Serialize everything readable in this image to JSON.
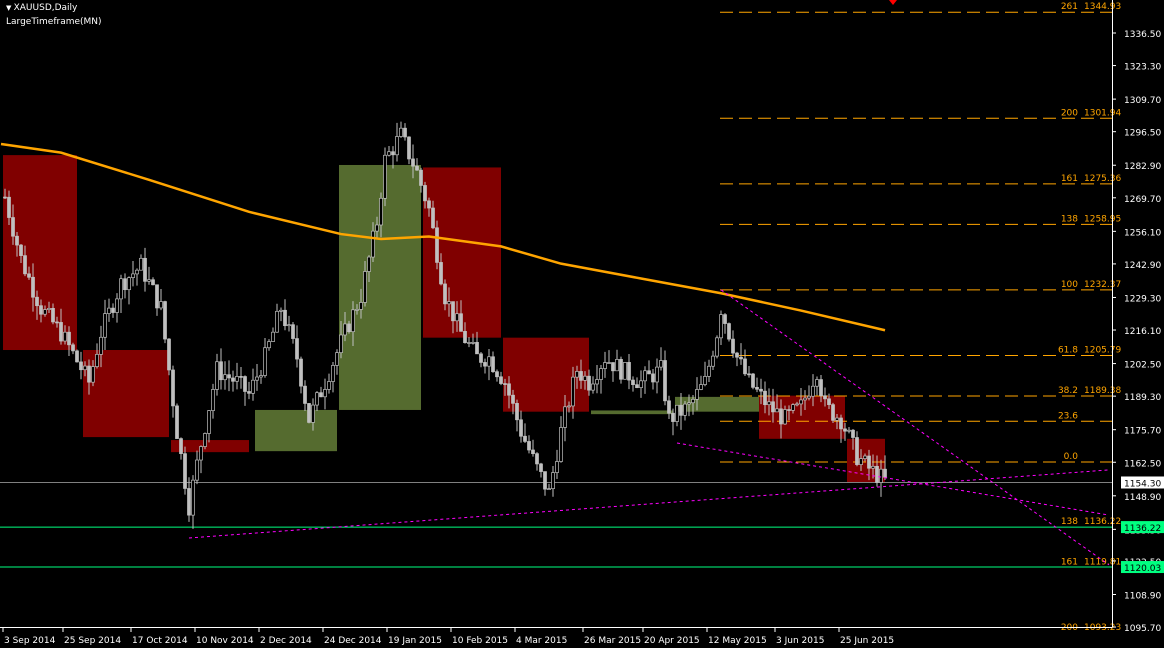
{
  "header": {
    "symbol_label": "XAUUSD,Daily",
    "indicator_label": "LargeTimeframe(MN)"
  },
  "colors": {
    "background": "#000000",
    "axis": "#ffffff",
    "candle": "#c0c0c0",
    "bear_box": "#800000",
    "bull_box": "#556b2f",
    "ma": "#ffa500",
    "fib": "#ffa500",
    "support": "#00ff80",
    "trend": "#ff00ff",
    "price_line": "#808080"
  },
  "chart_data": {
    "type": "candlestick",
    "title": "XAUUSD,Daily",
    "ylim": [
      1090,
      1350
    ],
    "y_ticks": [
      "1336.50",
      "1323.30",
      "1309.70",
      "1296.50",
      "1282.90",
      "1269.70",
      "1256.10",
      "1242.90",
      "1229.30",
      "1216.10",
      "1202.50",
      "1189.30",
      "1175.70",
      "1162.50",
      "1148.90",
      "1135.30",
      "1122.50",
      "1108.90",
      "1095.70"
    ],
    "x_ticks": [
      {
        "day": 0,
        "label": "3 Sep 2014"
      },
      {
        "day": 15,
        "label": "25 Sep 2014"
      },
      {
        "day": 32,
        "label": "17 Oct 2014"
      },
      {
        "day": 48,
        "label": "10 Nov 2014"
      },
      {
        "day": 64,
        "label": "2 Dec 2014"
      },
      {
        "day": 80,
        "label": "24 Dec 2014"
      },
      {
        "day": 96,
        "label": "19 Jan 2015"
      },
      {
        "day": 112,
        "label": "10 Feb 2015"
      },
      {
        "day": 128,
        "label": "4 Mar 2015"
      },
      {
        "day": 145,
        "label": "26 Mar 2015"
      },
      {
        "day": 160,
        "label": "20 Apr 2015"
      },
      {
        "day": 176,
        "label": "12 May 2015"
      },
      {
        "day": 193,
        "label": "3 Jun 2015"
      },
      {
        "day": 209,
        "label": "25 Jun 2015"
      }
    ],
    "daily_close_keypoints": [
      [
        0,
        1270
      ],
      [
        4,
        1245
      ],
      [
        9,
        1225
      ],
      [
        14,
        1215
      ],
      [
        21,
        1195
      ],
      [
        24,
        1215
      ],
      [
        29,
        1235
      ],
      [
        34,
        1242
      ],
      [
        39,
        1225
      ],
      [
        43,
        1175
      ],
      [
        46,
        1145
      ],
      [
        49,
        1170
      ],
      [
        53,
        1200
      ],
      [
        58,
        1195
      ],
      [
        61,
        1190
      ],
      [
        65,
        1205
      ],
      [
        69,
        1225
      ],
      [
        73,
        1205
      ],
      [
        76,
        1180
      ],
      [
        80,
        1195
      ],
      [
        85,
        1215
      ],
      [
        89,
        1230
      ],
      [
        93,
        1260
      ],
      [
        95,
        1285
      ],
      [
        99,
        1295
      ],
      [
        103,
        1280
      ],
      [
        106,
        1265
      ],
      [
        110,
        1230
      ],
      [
        114,
        1215
      ],
      [
        118,
        1205
      ],
      [
        121,
        1205
      ],
      [
        125,
        1195
      ],
      [
        129,
        1175
      ],
      [
        133,
        1160
      ],
      [
        136,
        1150
      ],
      [
        139,
        1175
      ],
      [
        143,
        1200
      ],
      [
        146,
        1195
      ],
      [
        150,
        1205
      ],
      [
        154,
        1200
      ],
      [
        159,
        1195
      ],
      [
        164,
        1200
      ],
      [
        166,
        1180
      ],
      [
        171,
        1185
      ],
      [
        175,
        1195
      ],
      [
        178,
        1215
      ],
      [
        179,
        1225
      ],
      [
        183,
        1205
      ],
      [
        186,
        1195
      ],
      [
        191,
        1185
      ],
      [
        195,
        1180
      ],
      [
        199,
        1185
      ],
      [
        203,
        1200
      ],
      [
        205,
        1185
      ],
      [
        209,
        1180
      ],
      [
        213,
        1165
      ],
      [
        216,
        1160
      ],
      [
        220,
        1155
      ]
    ],
    "monthly_boxes": [
      {
        "month": "Sep 2014",
        "start": 0,
        "end": 18,
        "open": 1287.0,
        "close": 1208.0
      },
      {
        "month": "Oct 2014",
        "start": 20,
        "end": 41,
        "open": 1208.0,
        "close": 1172.7
      },
      {
        "month": "Nov 2014",
        "start": 42,
        "end": 61,
        "open": 1171.5,
        "close": 1166.6
      },
      {
        "month": "Dec 2014",
        "start": 63,
        "end": 83,
        "open": 1167.0,
        "close": 1183.7
      },
      {
        "month": "Jan 2015",
        "start": 84,
        "end": 104,
        "open": 1183.7,
        "close": 1283.0
      },
      {
        "month": "Feb 2015",
        "start": 105,
        "end": 124,
        "open": 1282.0,
        "close": 1213.0
      },
      {
        "month": "Mar 2015",
        "start": 125,
        "end": 146,
        "open": 1213.0,
        "close": 1183.0
      },
      {
        "month": "Apr 2015",
        "start": 147,
        "end": 167,
        "open": 1182.0,
        "close": 1183.5
      },
      {
        "month": "May 2015",
        "start": 168,
        "end": 189,
        "open": 1183.0,
        "close": 1189.0
      },
      {
        "month": "Jun 2015",
        "start": 189,
        "end": 210,
        "open": 1189.5,
        "close": 1172.0
      },
      {
        "month": "Jul 2015",
        "start": 211,
        "end": 220,
        "open": 1172.0,
        "close": 1154.3
      }
    ],
    "moving_average": [
      [
        -1,
        1291.5
      ],
      [
        14,
        1288
      ],
      [
        36,
        1277
      ],
      [
        61,
        1264
      ],
      [
        84,
        1255
      ],
      [
        94,
        1253
      ],
      [
        106,
        1254
      ],
      [
        124,
        1250
      ],
      [
        139,
        1243
      ],
      [
        159,
        1237
      ],
      [
        179,
        1231
      ],
      [
        199,
        1224
      ],
      [
        220,
        1216
      ]
    ],
    "fib_levels": [
      {
        "level": "261",
        "price_label": "1344.93",
        "price": 1344.93
      },
      {
        "level": "200",
        "price_label": "1301.94",
        "price": 1301.94
      },
      {
        "level": "161",
        "price_label": "1275.36",
        "price": 1275.36
      },
      {
        "level": "138",
        "price_label": "1258.95",
        "price": 1258.95
      },
      {
        "level": "100",
        "price_label": "1232.37",
        "price": 1232.37
      },
      {
        "level": "61.8",
        "price_label": "1205.79",
        "price": 1205.79
      },
      {
        "level": "38.2",
        "price_label": "1189.38",
        "price": 1189.38
      },
      {
        "level": "23.6",
        "price_label": "",
        "price": 1179.1
      },
      {
        "level": "0.0",
        "price_label": "",
        "price": 1162.6
      }
    ],
    "projection_levels": [
      {
        "level": "138",
        "price_label": "1136.22",
        "price": 1136.22
      },
      {
        "level": "161",
        "price_label": "1119.81",
        "price": 1119.81
      },
      {
        "level": "200",
        "price_label": "1093.23",
        "price": 1093.23
      }
    ],
    "support_lines": [
      {
        "price": 1136.22,
        "label": "1136.22"
      },
      {
        "price": 1120.03,
        "label": "1120.03"
      }
    ],
    "current_price": {
      "price": 1154.3,
      "label": "1154.30"
    },
    "trendlines": [
      [
        [
          46,
          1131.8
        ],
        [
          276,
          1159.4
        ]
      ],
      [
        [
          168,
          1170.3
        ],
        [
          276,
          1141.1
        ]
      ],
      [
        [
          179,
          1232.4
        ],
        [
          276,
          1120.9
        ]
      ]
    ]
  }
}
